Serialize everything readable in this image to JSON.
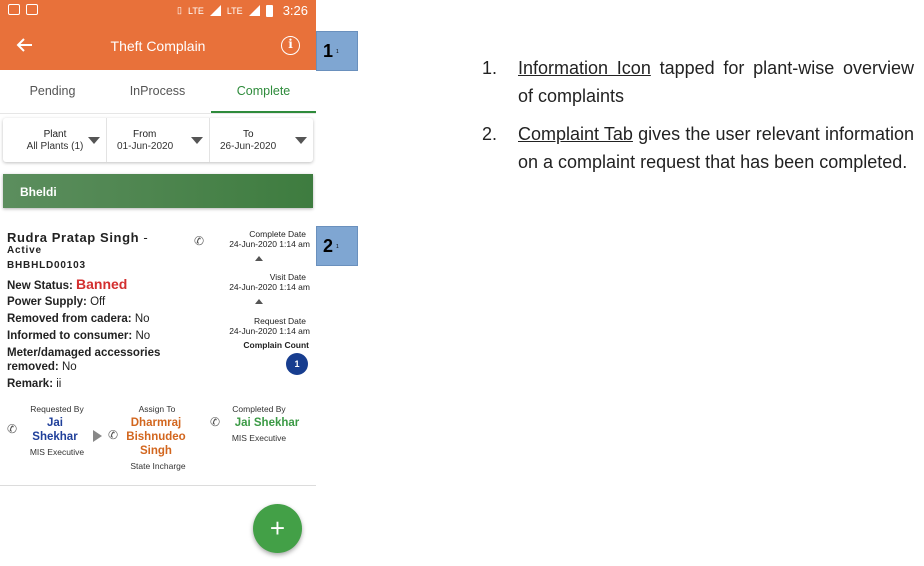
{
  "status_bar": {
    "time": "3:26",
    "net1": "LTE",
    "net2": "LTE"
  },
  "app_bar": {
    "title": "Theft Complain",
    "back_icon": "arrow-left-icon",
    "info_icon": "info-icon"
  },
  "tabs": [
    "Pending",
    "InProcess",
    "Complete"
  ],
  "active_tab": "Complete",
  "filters": {
    "plant": {
      "label": "Plant",
      "value": "All Plants (1)"
    },
    "from": {
      "label": "From",
      "value": "01-Jun-2020"
    },
    "to": {
      "label": "To",
      "value": "26-Jun-2020"
    }
  },
  "plant_header": "Bheldi",
  "complaint": {
    "name": "Rudra Pratap Singh",
    "name_suffix": " -",
    "state": "Active",
    "code": "BHBHLD00103",
    "new_status_label": "New Status: ",
    "new_status_value": "Banned",
    "power_supply_label": "Power Supply: ",
    "power_supply_value": "Off",
    "removed_label": "Removed from cadera: ",
    "removed_value": "No",
    "informed_label": "Informed to consumer: ",
    "informed_value": "No",
    "meter_label_1": "Meter/damaged accessories",
    "meter_label_2": "removed: ",
    "meter_value": "No",
    "remark_label": "Remark: ",
    "remark_value": "ii",
    "complete_date_label": "Complete Date",
    "complete_date_value": "24-Jun-2020 1:14 am",
    "visit_date_label": "Visit Date",
    "visit_date_value": "24-Jun-2020 1:14 am",
    "request_date_label": "Request Date",
    "request_date_value": "24-Jun-2020 1:14 am",
    "complain_count_label": "Complain Count",
    "complain_count": "1",
    "requested_by_label": "Requested By",
    "requested_by_name_1": "Jai",
    "requested_by_name_2": "Shekhar",
    "requested_by_role": "MIS Executive",
    "assign_to_label": "Assign To",
    "assign_to_name_1": "Dharmraj",
    "assign_to_name_2": "Bishnudeo",
    "assign_to_name_3": "Singh",
    "assign_to_role": "State Incharge",
    "completed_by_label": "Completed By",
    "completed_by_name": "Jai Shekhar",
    "completed_by_role": "MIS Executive"
  },
  "fab_label": "+",
  "callouts": [
    {
      "number": "1",
      "mark": "1"
    },
    {
      "number": "2",
      "mark": "1"
    }
  ],
  "notes": [
    {
      "num": "1.",
      "term": "Information Icon",
      "text": " tapped for plant-wise overview of complaints"
    },
    {
      "num": "2.",
      "term": "Complaint Tab",
      "text": " gives the user relevant information on a complaint request that has been completed."
    }
  ],
  "colors": {
    "app_bar": "#e8713a",
    "active_tab": "#2e8b3b",
    "banned": "#d32f2f",
    "fab": "#43a047",
    "callout": "#7fa6d2"
  }
}
